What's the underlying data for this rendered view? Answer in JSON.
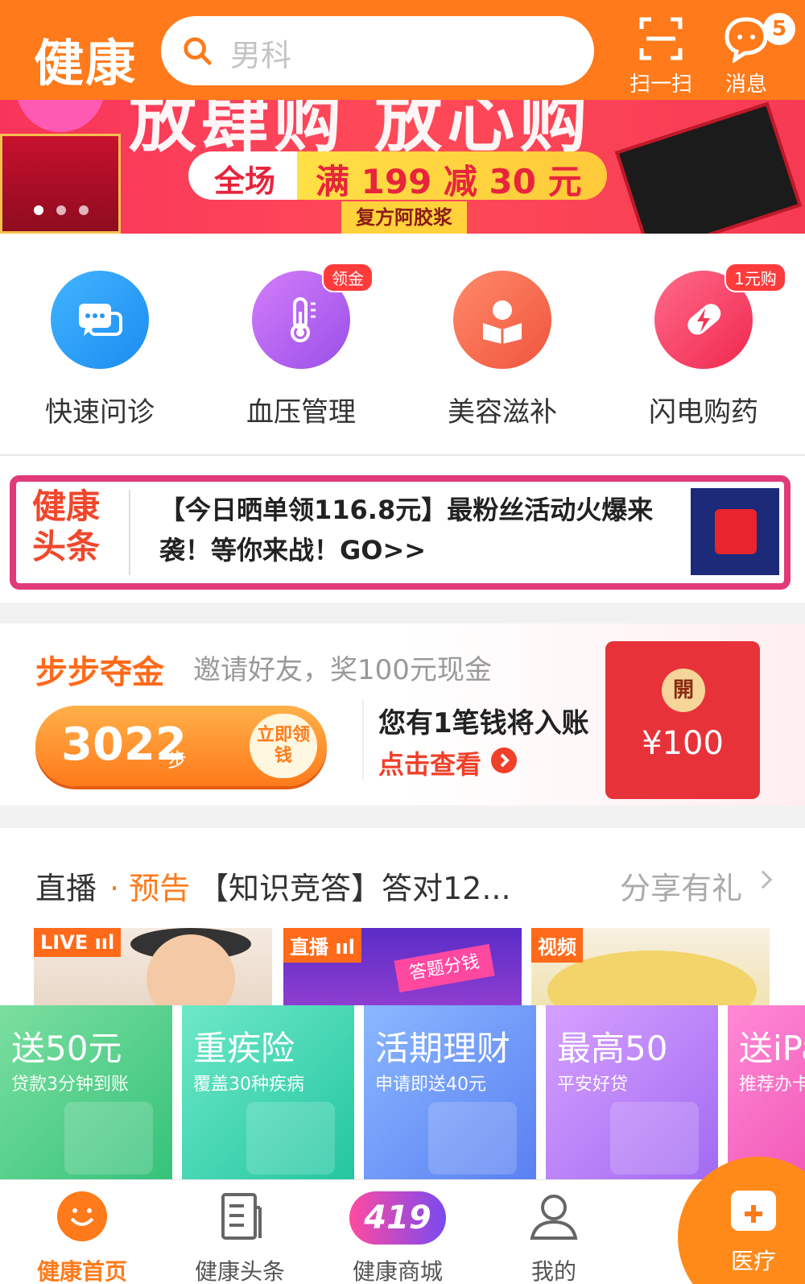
{
  "header": {
    "logo": "健康",
    "search_placeholder": "男科",
    "scan_label": "扫一扫",
    "message_label": "消息",
    "message_badge": "5"
  },
  "banner": {
    "headline": "放肆购 放心购",
    "pill_left": "全场",
    "pill_right": "满 199 减 30 元",
    "seal": "复方阿胶浆"
  },
  "quick": [
    {
      "label": "快速问诊",
      "tag": ""
    },
    {
      "label": "血压管理",
      "tag": "领金"
    },
    {
      "label": "美容滋补",
      "tag": ""
    },
    {
      "label": "闪电购药",
      "tag": "1元购"
    }
  ],
  "headline_news": {
    "tag": "健康头条",
    "text": "【今日晒单领116.8元】最粉丝活动火爆来袭！等你来战！GO>>"
  },
  "steps": {
    "title": "步步夺金",
    "subtitle": "邀请好友，奖100元现金",
    "count": "3022",
    "unit": "步",
    "claim": "立即领钱",
    "line1": "您有1笔钱将入账",
    "line2": "点击查看",
    "envelope_coin": "開",
    "envelope_amount": "¥100"
  },
  "live": {
    "title": "直播",
    "preview": "· 预告",
    "topic": "【知识竞答】答对12...",
    "share": "分享有礼",
    "cards": [
      {
        "label": "LIVE ııl"
      },
      {
        "label": "直播 ııl",
        "bubble": "答题分钱"
      },
      {
        "label": "视频"
      }
    ]
  },
  "finance": [
    {
      "title": "送50元",
      "sub": "贷款3分钟到账"
    },
    {
      "title": "重疾险",
      "sub": "覆盖30种疾病"
    },
    {
      "title": "活期理财",
      "sub": "申请即送40元"
    },
    {
      "title": "最高50",
      "sub": "平安好贷"
    },
    {
      "title": "送iPa",
      "sub": "推荐办卡"
    }
  ],
  "nav": [
    {
      "label": "健康首页"
    },
    {
      "label": "健康头条"
    },
    {
      "label": "健康商城",
      "badge": "419"
    },
    {
      "label": "我的"
    },
    {
      "label": "医疗"
    }
  ],
  "colors": {
    "brand": "#ff7a1a",
    "news_border": "#e03a7a"
  }
}
